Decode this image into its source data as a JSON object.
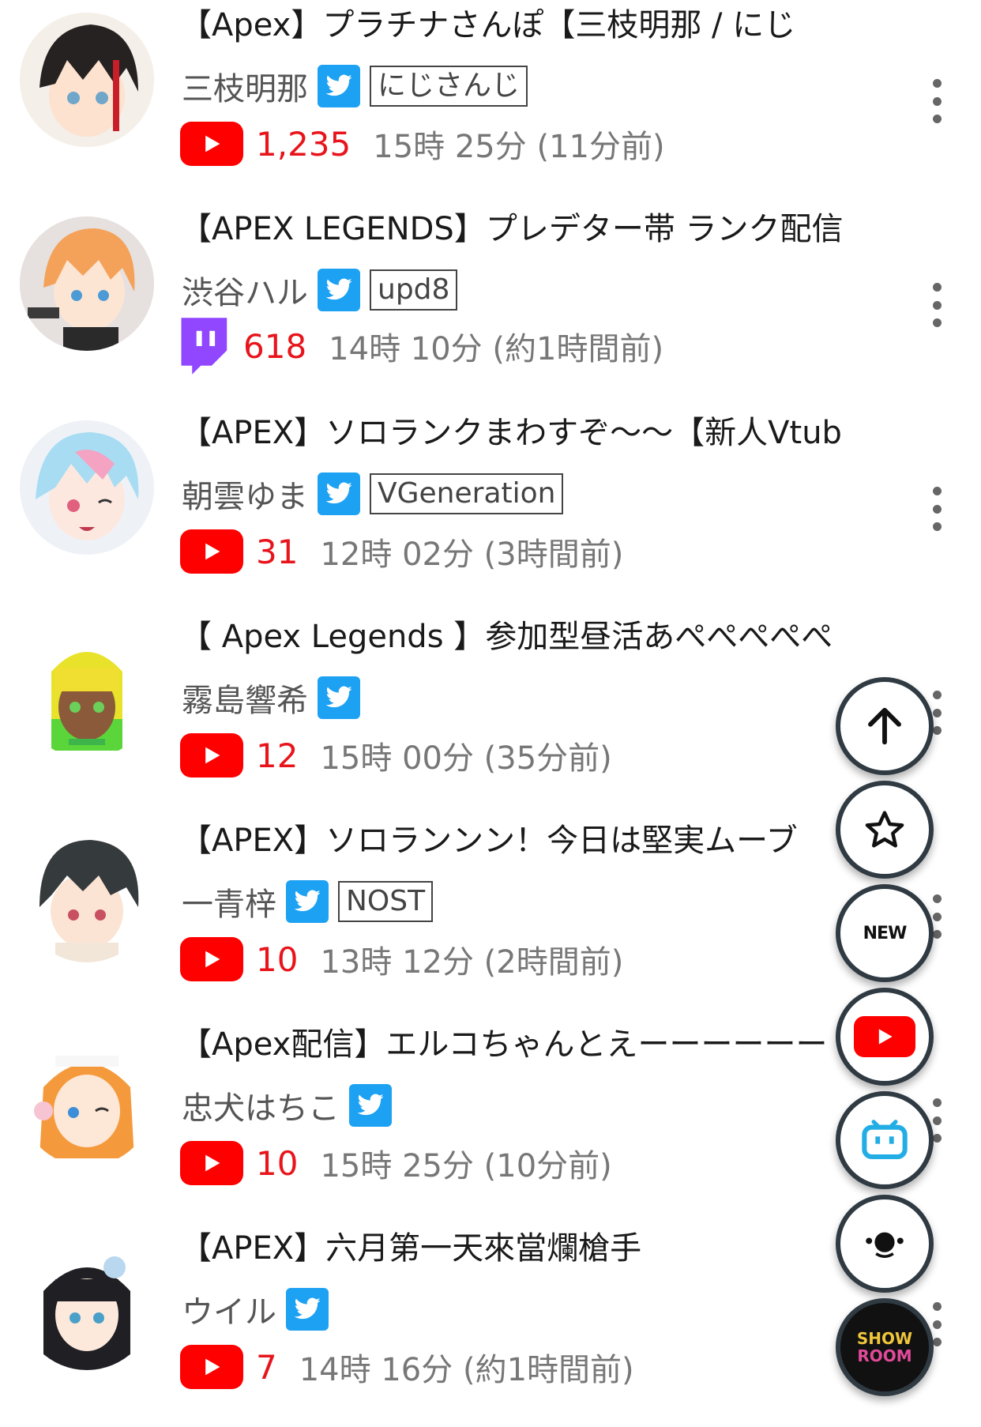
{
  "streams": [
    {
      "title": "【Apex】プラチナさんぽ【三枝明那 / にじ",
      "channel": "三枝明那",
      "org": "にじさんじ",
      "platform": "youtube",
      "viewers": "1,235",
      "time": "15時 25分 (11分前)"
    },
    {
      "title": "【APEX LEGENDS】プレデター帯 ランク配信",
      "channel": "渋谷ハル",
      "org": "upd8",
      "platform": "twitch",
      "viewers": "618",
      "time": "14時 10分 (約1時間前)"
    },
    {
      "title": "【APEX】ソロランクまわすぞ〜〜【新人Vtub",
      "channel": "朝雲ゆま",
      "org": "VGeneration",
      "platform": "youtube",
      "viewers": "31",
      "time": "12時 02分 (3時間前)"
    },
    {
      "title": "【 Apex Legends 】参加型昼活あぺぺぺぺぺ",
      "channel": "霧島響希",
      "org": "",
      "platform": "youtube",
      "viewers": "12",
      "time": "15時 00分 (35分前)"
    },
    {
      "title": "【APEX】ソロランンン！今日は堅実ムーブ",
      "channel": "一青梓",
      "org": "NOST",
      "platform": "youtube",
      "viewers": "10",
      "time": "13時 12分 (2時間前)"
    },
    {
      "title": "【Apex配信】エルコちゃんとえーーーーーー",
      "channel": "忠犬はちこ",
      "org": "",
      "platform": "youtube",
      "viewers": "10",
      "time": "15時 25分 (10分前)"
    },
    {
      "title": "【APEX】六月第一天來當爛槍手",
      "channel": "ウイル",
      "org": "",
      "platform": "youtube",
      "viewers": "7",
      "time": "14時 16分 (約1時間前)"
    }
  ],
  "fab": {
    "new_label": "NEW",
    "showroom_label_1": "SHOW",
    "showroom_label_2": "ROOM"
  },
  "colors": {
    "youtube_red": "#ff0000",
    "twitch_purple": "#9146ff",
    "twitter_blue": "#1da1f2",
    "viewer_red": "#e8141b",
    "fab_border": "#2f3a42"
  }
}
